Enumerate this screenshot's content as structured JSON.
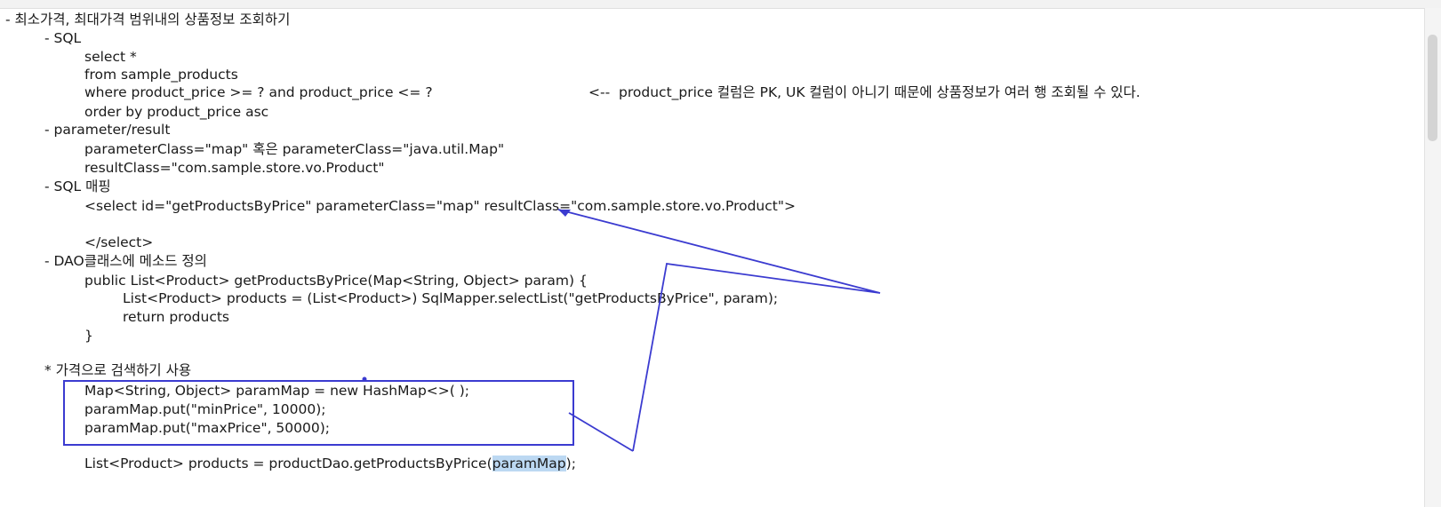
{
  "document": {
    "lines": [
      {
        "indent": 0,
        "text": "- 최소가격, 최대가격 범위내의 상품정보 조회하기"
      },
      {
        "indent": 1,
        "text": "- SQL"
      },
      {
        "indent": 2,
        "text": "select *"
      },
      {
        "indent": 2,
        "text": "from sample_products"
      },
      {
        "indent": 2,
        "text": "where product_price >= ? and product_price <= ?"
      },
      {
        "indent": 2,
        "text": "order by product_price asc"
      },
      {
        "indent": 1,
        "text": "- parameter/result"
      },
      {
        "indent": 2,
        "text": "parameterClass=\"map\" 혹은 parameterClass=\"java.util.Map\""
      },
      {
        "indent": 2,
        "text": "resultClass=\"com.sample.store.vo.Product\""
      },
      {
        "indent": 1,
        "text": "- SQL 매핑"
      },
      {
        "indent": 2,
        "text": "<select id=\"getProductsByPrice\" parameterClass=\"map\" resultClass=\"com.sample.store.vo.Product\">"
      },
      {
        "indent": 2,
        "text": ""
      },
      {
        "indent": 2,
        "text": "</select>"
      },
      {
        "indent": 1,
        "text": "- DAO클래스에 메소드 정의"
      },
      {
        "indent": 2,
        "text": "public List<Product> getProductsByPrice(Map<String, Object> param) {"
      },
      {
        "indent": 3,
        "text": "List<Product> products = (List<Product>) SqlMapper.selectList(\"getProductsByPrice\", param);"
      },
      {
        "indent": 3,
        "text": "return products"
      },
      {
        "indent": 2,
        "text": "}"
      },
      {
        "indent": 2,
        "text": ""
      },
      {
        "indent": 1,
        "text": "* 가격으로 검색하기 사용"
      },
      {
        "indent": 2,
        "text": "Map<String, Object> paramMap = new HashMap<>( );"
      },
      {
        "indent": 2,
        "text": "paramMap.put(\"minPrice\", 10000);"
      },
      {
        "indent": 2,
        "text": "paramMap.put(\"maxPrice\", 50000);"
      },
      {
        "indent": 2,
        "text": ""
      }
    ],
    "last_line_prefix": "List<Product> products = productDao.getProductsByPrice(",
    "last_line_highlight": "paramMap",
    "last_line_suffix": ");",
    "side_note": "<--  product_price 컬럼은 PK, UK 컬럼이 아니기 때문에 상품정보가 여러 행 조회될 수 있다."
  },
  "colors": {
    "annotation": "#3b3bd0",
    "highlight": "#bcd8f2",
    "text": "#1a1a1a"
  }
}
